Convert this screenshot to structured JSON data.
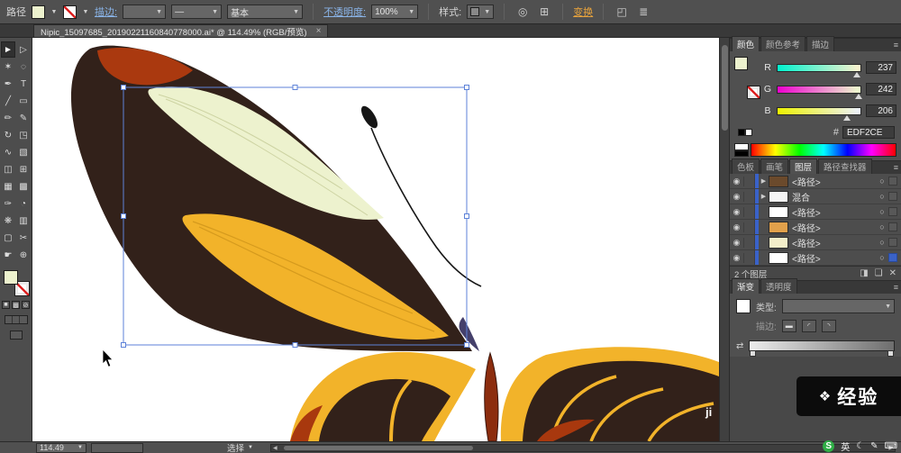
{
  "control_bar": {
    "context_label": "路径",
    "stroke_link": "描边:",
    "profile_value": "—",
    "brush_value": "基本",
    "opacity_link": "不透明度:",
    "opacity_value": "100%",
    "style_label": "样式:",
    "transform_link": "变换"
  },
  "document_tab": {
    "title": "Nipic_15097685_20190221160840778000.ai* @ 114.49% (RGB/预览)",
    "close_label": "×"
  },
  "toolbox": {
    "tools": [
      {
        "name": "selection",
        "glyph": "►"
      },
      {
        "name": "direct-selection",
        "glyph": "▷"
      },
      {
        "name": "magic-wand",
        "glyph": "✶"
      },
      {
        "name": "lasso",
        "glyph": "◌"
      },
      {
        "name": "pen",
        "glyph": "✒"
      },
      {
        "name": "type",
        "glyph": "T"
      },
      {
        "name": "line-segment",
        "glyph": "╱"
      },
      {
        "name": "rectangle",
        "glyph": "▭"
      },
      {
        "name": "paintbrush",
        "glyph": "✏"
      },
      {
        "name": "pencil",
        "glyph": "✎"
      },
      {
        "name": "rotate",
        "glyph": "↻"
      },
      {
        "name": "scale",
        "glyph": "◳"
      },
      {
        "name": "width",
        "glyph": "∿"
      },
      {
        "name": "free-transform",
        "glyph": "▧"
      },
      {
        "name": "shape-builder",
        "glyph": "◫"
      },
      {
        "name": "perspective-grid",
        "glyph": "⊞"
      },
      {
        "name": "mesh",
        "glyph": "▦"
      },
      {
        "name": "gradient",
        "glyph": "▩"
      },
      {
        "name": "eyedropper",
        "glyph": "✑"
      },
      {
        "name": "blend",
        "glyph": "◔"
      },
      {
        "name": "symbol-sprayer",
        "glyph": "❋"
      },
      {
        "name": "column-graph",
        "glyph": "▥"
      },
      {
        "name": "artboard",
        "glyph": "▢"
      },
      {
        "name": "slice",
        "glyph": "✂"
      },
      {
        "name": "hand",
        "glyph": "☛"
      },
      {
        "name": "zoom",
        "glyph": "⊕"
      }
    ],
    "modes": {
      "color": "■",
      "gradient": "▩",
      "none": "⊘"
    }
  },
  "color_panel": {
    "tabs": [
      "颜色",
      "颜色参考",
      "描边"
    ],
    "channels": [
      {
        "label": "R",
        "value": "237"
      },
      {
        "label": "G",
        "value": "242"
      },
      {
        "label": "B",
        "value": "206"
      }
    ],
    "hex_label": "#",
    "hex_value": "EDF2CE"
  },
  "panel2": {
    "tabs": [
      "色板",
      "画笔",
      "图层",
      "路径查找器"
    ]
  },
  "layers": {
    "eye_glyph": "◉",
    "target_glyph": "○",
    "rows": [
      {
        "expand": "▶",
        "name": "<路径>",
        "thumb": "#6b4a2c"
      },
      {
        "expand": "▶",
        "name": "混合",
        "thumb": "#f5f5f5"
      },
      {
        "expand": "",
        "name": "<路径>",
        "thumb": "#ffffff"
      },
      {
        "expand": "",
        "name": "<路径>",
        "thumb": "#e2a14b"
      },
      {
        "expand": "",
        "name": "<路径>",
        "thumb": "#f3eec9"
      },
      {
        "expand": "",
        "name": "<路径>",
        "thumb": "#ffffff"
      }
    ],
    "count_label": "2 个图层",
    "footer_icons": {
      "mask": "◨",
      "new_layer": "❏",
      "delete": "✕"
    }
  },
  "panel3": {
    "tabs": [
      "渐变",
      "透明度"
    ]
  },
  "gradient_panel": {
    "type_label": "类型:",
    "stroke_label": "描边:",
    "stroke_icons": [
      "▬",
      "◜",
      "◝"
    ],
    "reverse_icon": "⇄"
  },
  "status_bar": {
    "zoom_value": "114.49",
    "tool_label": "选择"
  },
  "watermark": {
    "logo": "❖",
    "text": "经验",
    "small_text": "ji"
  },
  "ime": {
    "items": [
      "S",
      "英",
      "☾",
      "✎",
      "⌨"
    ]
  },
  "icons": {
    "dropdown": "▼",
    "menu": "≡",
    "recolor": "◎",
    "align": "⊞",
    "isolate": "◰",
    "arrange": "≣",
    "left_arrow": "◀",
    "right_arrow": "▶"
  },
  "colors": {
    "accent": "#3A62C8",
    "fill": "#EDF2CE",
    "wing_dark": "#32211A",
    "wing_orange": "#AA390F",
    "wing_yellow": "#F2B32A",
    "wing_cream": "#EDF2CE",
    "body_red": "#8C2D0E"
  }
}
